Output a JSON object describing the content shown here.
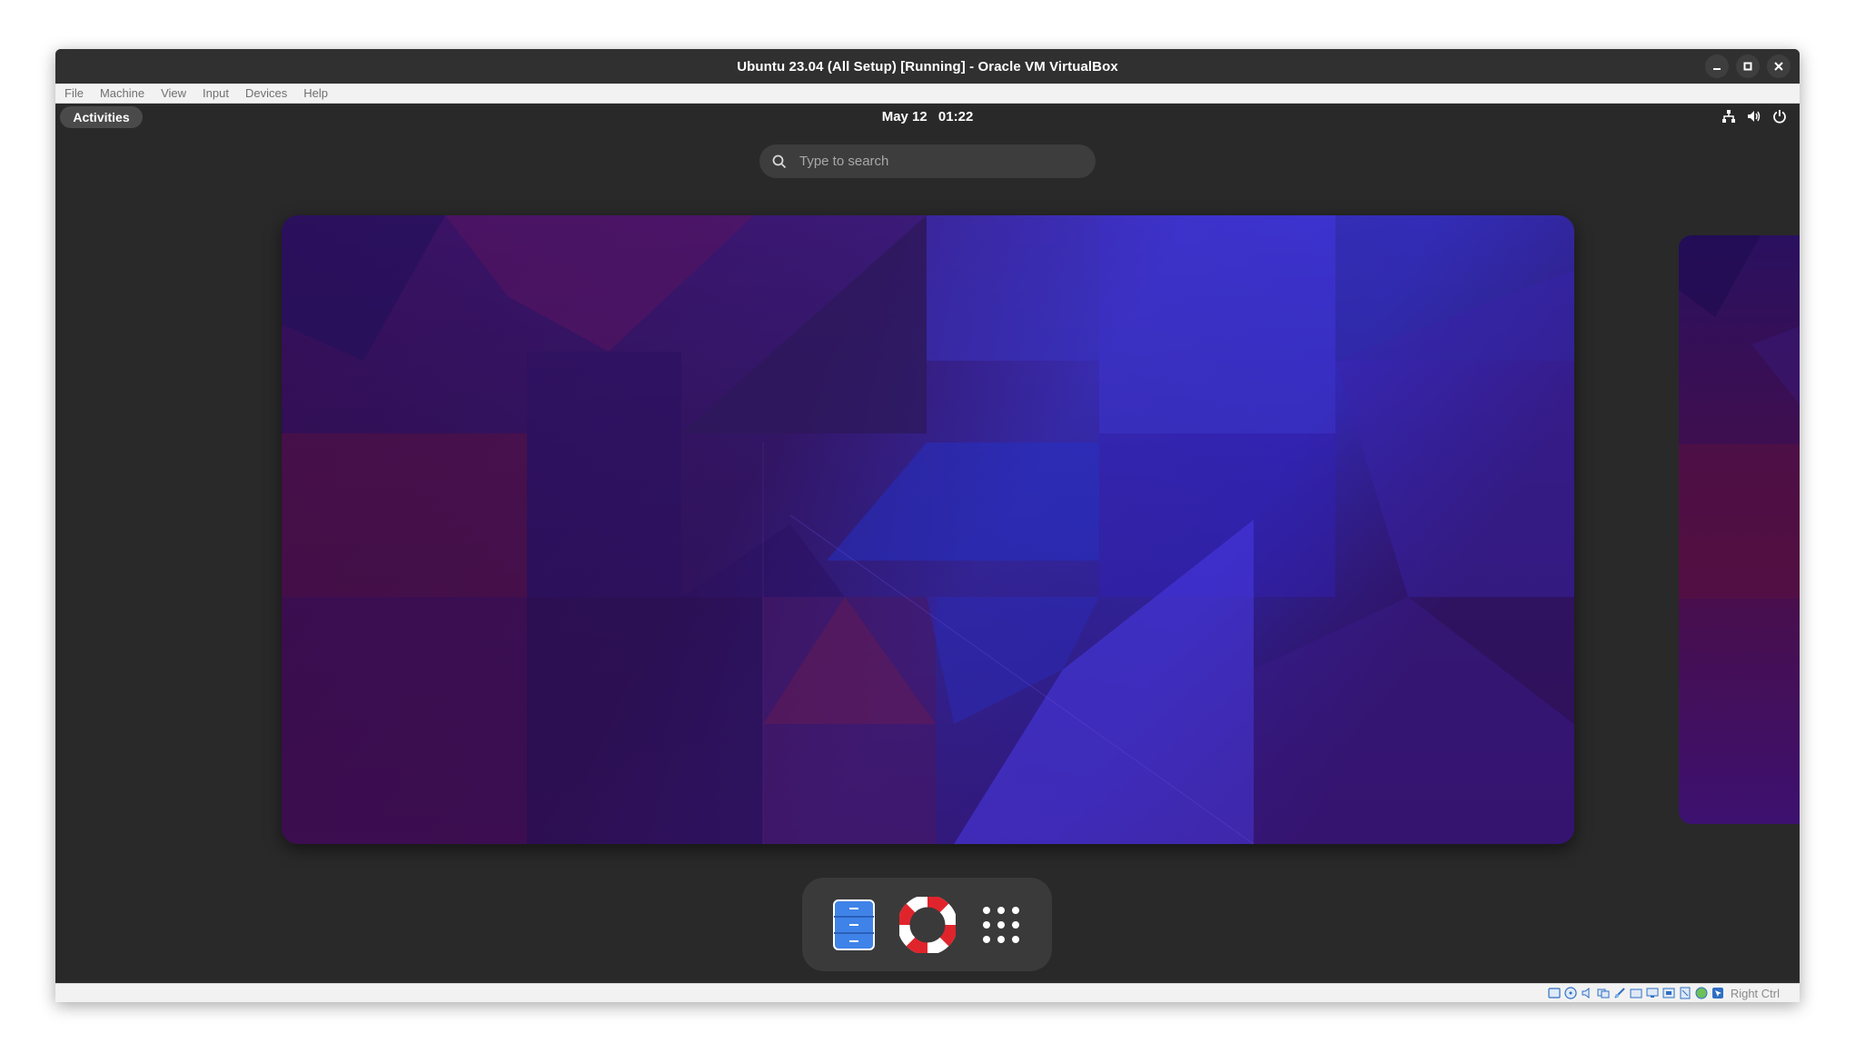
{
  "window": {
    "title": "Ubuntu 23.04 (All Setup) [Running] - Oracle VM VirtualBox"
  },
  "menubar": {
    "items": [
      "File",
      "Machine",
      "View",
      "Input",
      "Devices",
      "Help"
    ]
  },
  "topbar": {
    "activities_label": "Activities",
    "date": "May 12",
    "time": "01:22"
  },
  "search": {
    "placeholder": "Type to search"
  },
  "dash": {
    "items": [
      "files-icon",
      "help-icon",
      "show-apps-grid-icon"
    ]
  },
  "statusbar": {
    "host_key": "Right Ctrl"
  },
  "colors": {
    "wallpaper_blue": "#3a2fd6",
    "wallpaper_purple": "#3d0f5c",
    "wallpaper_red": "#5a1440"
  }
}
